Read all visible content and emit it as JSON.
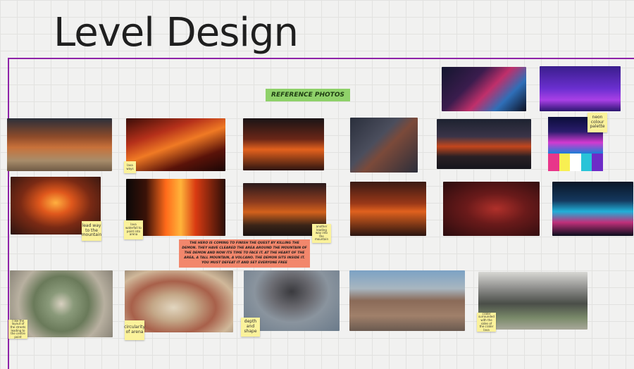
{
  "board": {
    "title": "Level Design",
    "reference_label": "REFERENCE PHOTOS",
    "description": "The hero is coming to finish the quest by killing the demon. They have cleared the area around the mountain of the demon and now its time to face it. At the heart of the area, a tall mountain, a volcano. The demon sits inside it. You must defeat it and set everyone free"
  },
  "stickies": {
    "neon": "neon colour palette",
    "lava_ways": "lava ways",
    "lead_way": "lead way to the mountain",
    "lava_waterfall": "lava waterfall to point into arena",
    "another_path": "another leading way into the mountain",
    "like_layout": "I like the layout of the streets leading to the centre point",
    "circularity": "circularity of arena",
    "depth_shape": "depth and shape",
    "crater": "crater surrounded with the sides of the crater lava"
  },
  "palette_colors": [
    "#e8368a",
    "#f8ef52",
    "#ffffff",
    "#29c4d8",
    "#6d2cc7"
  ]
}
